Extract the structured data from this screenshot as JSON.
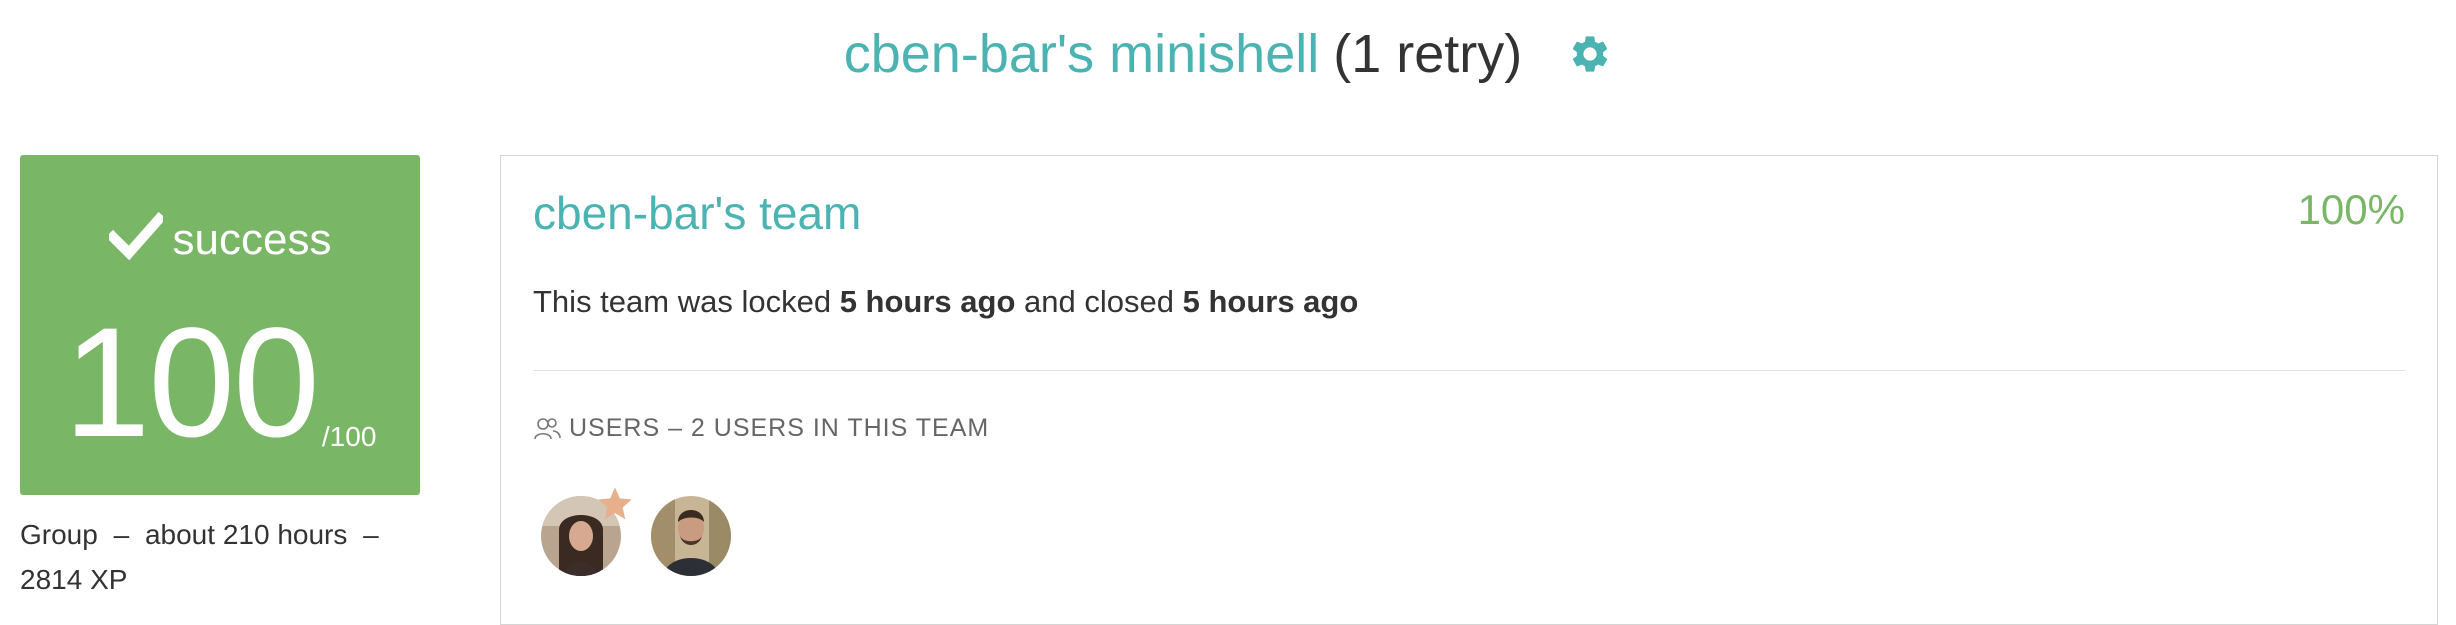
{
  "header": {
    "project_name": "cben-bar's minishell",
    "retry_text": "(1 retry)",
    "settings_icon": "gear-icon",
    "colors": {
      "project": "#4cb3b3",
      "retry": "#333333"
    }
  },
  "grade": {
    "status_label": "success",
    "status_icon": "check-icon",
    "score": "100",
    "max_score": "/100",
    "color": "#79b767"
  },
  "grade_info": {
    "type": "Group",
    "duration": "about 210 hours",
    "xp": "2814 XP",
    "separator": "–"
  },
  "team": {
    "name": "cben-bar's team",
    "percent": "100%",
    "status_prefix": "This team was locked",
    "locked_time": "5 hours ago",
    "status_middle": "and closed",
    "closed_time": "5 hours ago",
    "users_header": "USERS – 2 USERS IN THIS TEAM",
    "users_icon": "users-icon",
    "members": [
      {
        "role": "leader",
        "badge_icon": "star-icon"
      },
      {
        "role": "member"
      }
    ]
  }
}
